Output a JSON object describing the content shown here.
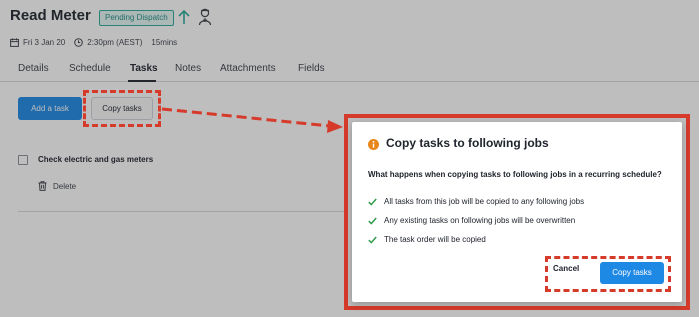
{
  "header": {
    "title": "Read Meter",
    "status_badge": "Pending Dispatch",
    "date": "Fri 3 Jan 20",
    "time": "2:30pm (AEST)",
    "duration": "15mins"
  },
  "tabs": [
    {
      "label": "Details"
    },
    {
      "label": "Schedule"
    },
    {
      "label": "Tasks",
      "active": true
    },
    {
      "label": "Notes"
    },
    {
      "label": "Attachments"
    },
    {
      "label": "Fields"
    }
  ],
  "tasks_panel": {
    "add_button": "Add a task",
    "copy_button": "Copy tasks",
    "tasks": [
      {
        "label": "Check electric and gas meters",
        "checked": false,
        "delete_label": "Delete"
      }
    ]
  },
  "modal": {
    "icon": "info-icon",
    "title": "Copy tasks to following jobs",
    "question": "What happens when copying tasks to following jobs in a recurring schedule?",
    "points": [
      "All tasks from this job will be copied to any following jobs",
      "Any existing tasks on following jobs will be overwritten",
      "The task order will be copied"
    ],
    "cancel_label": "Cancel",
    "confirm_label": "Copy tasks"
  },
  "colors": {
    "primary": "#1e88e5",
    "badge_teal": "#2aa89a",
    "check_green": "#2e9c4a",
    "info_orange": "#e8861a",
    "annotation_red": "#d63a2b"
  }
}
